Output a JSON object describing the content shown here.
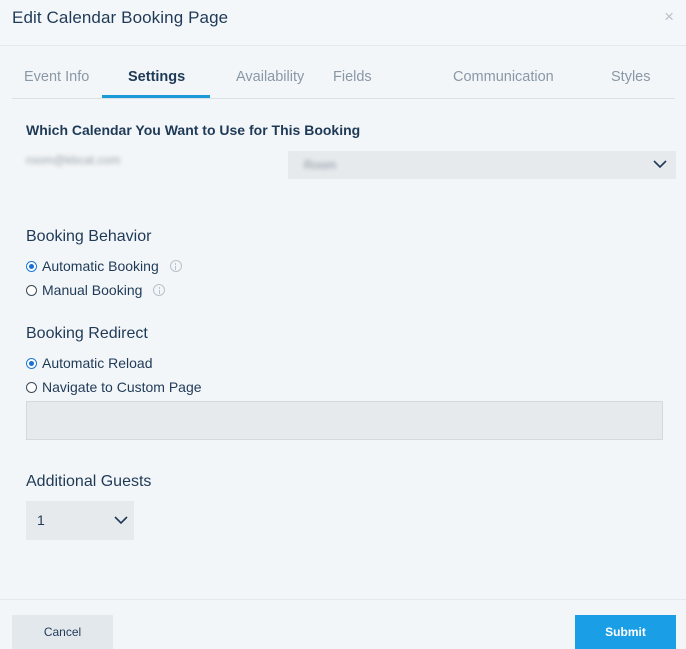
{
  "modal": {
    "title": "Edit Calendar Booking Page",
    "close_label": "×"
  },
  "tabs": [
    {
      "label": "Event Info",
      "active": false
    },
    {
      "label": "Settings",
      "active": true
    },
    {
      "label": "Availability",
      "active": false
    },
    {
      "label": "Fields",
      "active": false
    },
    {
      "label": "Communication",
      "active": false
    },
    {
      "label": "Styles",
      "active": false
    }
  ],
  "calendar": {
    "label": "Which Calendar You Want to Use for This Booking",
    "account": "room@kbcat.com",
    "selected": "Room"
  },
  "booking_behavior": {
    "heading": "Booking Behavior",
    "options": [
      {
        "label": "Automatic Booking",
        "checked": true
      },
      {
        "label": "Manual Booking",
        "checked": false
      }
    ]
  },
  "booking_redirect": {
    "heading": "Booking Redirect",
    "options": [
      {
        "label": "Automatic Reload",
        "checked": true
      },
      {
        "label": "Navigate to Custom Page",
        "checked": false
      }
    ],
    "custom_url_value": ""
  },
  "additional_guests": {
    "heading": "Additional Guests",
    "value": "1"
  },
  "footer": {
    "cancel_label": "Cancel",
    "submit_label": "Submit"
  },
  "colors": {
    "accent": "#1a9ad6",
    "submit_bg": "#1a9ee6",
    "background": "#f3f6f8"
  }
}
